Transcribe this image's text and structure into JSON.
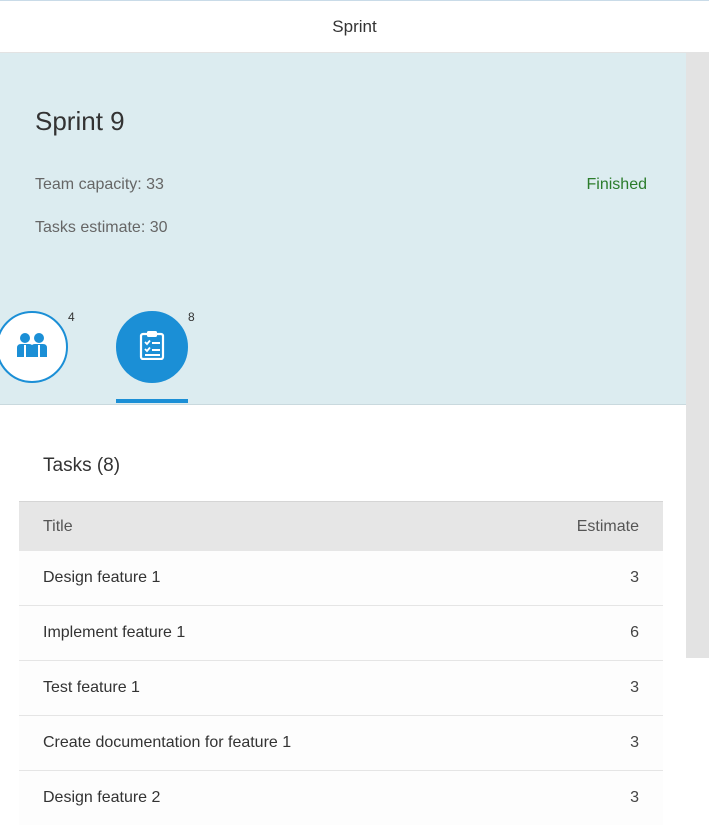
{
  "header": {
    "title": "Sprint"
  },
  "sprint": {
    "title": "Sprint 9",
    "team_capacity": "Team capacity: 33",
    "tasks_estimate": "Tasks estimate: 30",
    "status": "Finished"
  },
  "icon_tabs": [
    {
      "icon": "team-icon",
      "count": "4",
      "selected": false
    },
    {
      "icon": "task-list-icon",
      "count": "8",
      "selected": true
    }
  ],
  "tasks": {
    "title": "Tasks (8)",
    "columns": {
      "title": "Title",
      "estimate": "Estimate"
    },
    "rows": [
      {
        "title": "Design feature 1",
        "estimate": "3"
      },
      {
        "title": "Implement feature 1",
        "estimate": "6"
      },
      {
        "title": "Test feature 1",
        "estimate": "3"
      },
      {
        "title": "Create documentation for feature 1",
        "estimate": "3"
      },
      {
        "title": "Design feature 2",
        "estimate": "3"
      }
    ]
  },
  "colors": {
    "accent": "#1b8fd6",
    "header_bg": "#dcecf0",
    "status_success": "#2b7c2b"
  }
}
